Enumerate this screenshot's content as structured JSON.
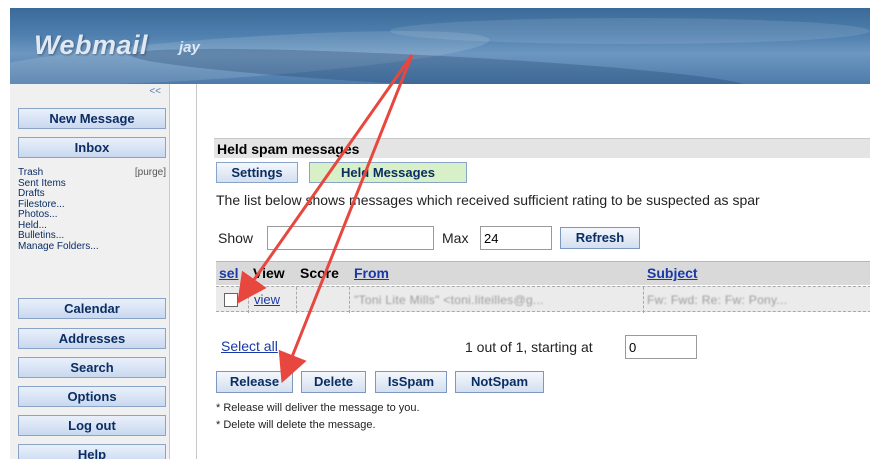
{
  "header": {
    "brand": "Webmail",
    "user": "jay"
  },
  "sidebar": {
    "collapse": "<<",
    "new_message": "New Message",
    "inbox": "Inbox",
    "folders": [
      {
        "name": "Trash",
        "extra": "[purge]"
      },
      {
        "name": "Sent Items",
        "extra": ""
      },
      {
        "name": "Drafts",
        "extra": ""
      },
      {
        "name": "Filestore...",
        "extra": ""
      },
      {
        "name": "Photos...",
        "extra": ""
      },
      {
        "name": "Held...",
        "extra": ""
      },
      {
        "name": "Bulletins...",
        "extra": ""
      },
      {
        "name": "Manage Folders...",
        "extra": ""
      }
    ],
    "calendar": "Calendar",
    "addresses": "Addresses",
    "search": "Search",
    "options": "Options",
    "logout": "Log out",
    "help": "Help"
  },
  "main": {
    "title": "Held spam messages",
    "tabs": {
      "settings": "Settings",
      "held": "Held Messages"
    },
    "description": "The list below shows messages which received sufficient rating to be suspected as spar",
    "filter": {
      "show_label": "Show",
      "show_value": "",
      "max_label": "Max",
      "max_value": "24",
      "refresh": "Refresh"
    },
    "table": {
      "headers": {
        "sel": "sel",
        "view": "View",
        "score": "Score",
        "from": "From",
        "subject": "Subject"
      },
      "row": {
        "view": "view",
        "from": "\"Toni Lite Mills\" <toni.liteilles@g...",
        "subject": "Fw: Fwd: Re: Fw: Pony..."
      }
    },
    "select_all": "Select all",
    "count_text": "1 out of 1, starting at",
    "start_value": "0",
    "actions": {
      "release": "Release",
      "delete": "Delete",
      "isspam": "IsSpam",
      "notspam": "NotSpam"
    },
    "notes": [
      "* Release will deliver the message to you.",
      "* Delete will delete the message."
    ]
  },
  "colors": {
    "arrow": "#e8473f",
    "held_tab": "#d8f0c8",
    "link": "#1a39a8"
  }
}
